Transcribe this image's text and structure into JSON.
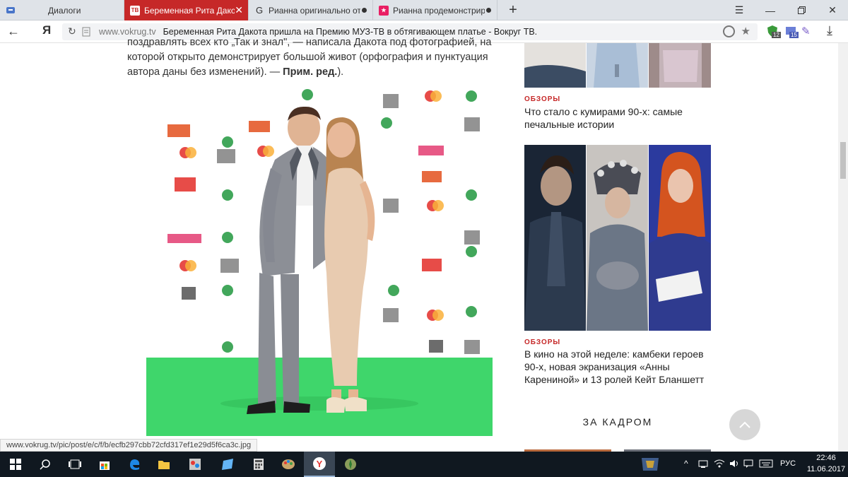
{
  "browser": {
    "tabs": [
      {
        "label": "Диалоги",
        "active": false
      },
      {
        "label": "Беременная Рита Дакота",
        "favicon": "TB",
        "active": true
      },
      {
        "label": "Рианна оригинально отв",
        "active": false
      },
      {
        "label": "Рианна продемонстриро",
        "active": false
      }
    ],
    "address": {
      "domain": "www.vokrug.tv",
      "page_title": "Беременная Рита Дакота пришла на Премию МУЗ-ТВ в обтягивающем платье - Вокруг ТВ.",
      "yandex_logo": "Я",
      "badge_12": "12",
      "badge_15": "15"
    }
  },
  "article": {
    "paragraph": "поздравлять всех кто „Так и знал\", — написала Дакота под фотографией, на которой открыто демонстрирует большой живот (орфография и пунктуация автора даны без изменений). — ",
    "note_bold": "Прим. ред.",
    "note_end": ")."
  },
  "sidebar": {
    "items": [
      {
        "category": "ОБЗОРЫ",
        "headline": "Что стало с кумирами 90-х: самые печальные истории"
      },
      {
        "category": "ОБЗОРЫ",
        "headline": "В кино на этой неделе: камбеки героев 90-х, новая экранизация «Анны Карениной» и 13 ролей Кейт Бланшетт"
      }
    ],
    "section_title": "ЗА КАДРОМ"
  },
  "status_url": "www.vokrug.tv/pic/post/e/c/f/b/ecfb297cbb72cfd317ef1e29d5f6ca3c.jpg",
  "taskbar": {
    "language": "РУС",
    "time": "22:46",
    "date": "11.06.2017"
  },
  "colors": {
    "accent": "#c62828",
    "carpet": "#3fd66b",
    "taskbar": "#101820"
  }
}
